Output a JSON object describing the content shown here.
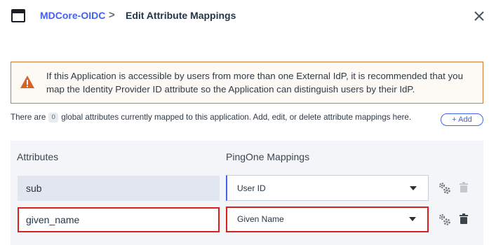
{
  "header": {
    "app_name": "MDCore-OIDC",
    "separator": ">",
    "title": "Edit Attribute Mappings"
  },
  "warning": {
    "text": "If this Application is accessible by users from more than one External IdP, it is recommended that you map the Identity Provider ID attribute so the Application can distinguish users by their IdP."
  },
  "info": {
    "prefix": "There are",
    "count": "0",
    "suffix": "global attributes currently mapped to this application. Add, edit, or delete attribute mappings here.",
    "add_label": "+ Add"
  },
  "table": {
    "col_attributes": "Attributes",
    "col_mappings": "PingOne Mappings",
    "rows": [
      {
        "attribute": "sub",
        "mapping": "User ID",
        "editable": false
      },
      {
        "attribute": "given_name",
        "mapping": "Given Name",
        "editable": true
      }
    ]
  },
  "colors": {
    "accent": "#4462ed",
    "warning_border": "#d47a36",
    "warning_icon": "#d5612b",
    "highlight_red": "#d8201c",
    "panel_bg": "#f3f5f8"
  },
  "icons": [
    "app-window-icon",
    "chevron-right-icon",
    "close-icon",
    "warning-icon",
    "gear-icon",
    "trash-icon",
    "caret-down-icon"
  ]
}
